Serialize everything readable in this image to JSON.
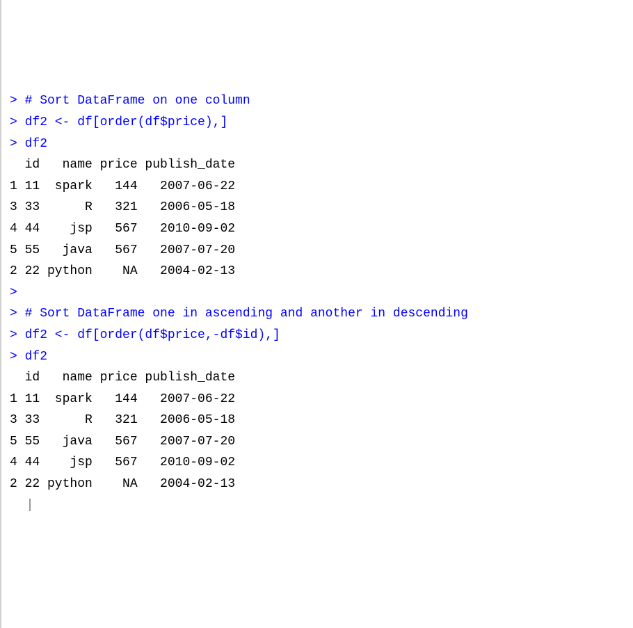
{
  "lines": [
    {
      "type": "prompt",
      "text": "> # Sort DataFrame on one column"
    },
    {
      "type": "prompt",
      "text": "> df2 <- df[order(df$price),]"
    },
    {
      "type": "prompt",
      "text": "> df2"
    },
    {
      "type": "output",
      "text": "  id   name price publish_date"
    },
    {
      "type": "output",
      "text": "1 11  spark   144   2007-06-22"
    },
    {
      "type": "output",
      "text": "3 33      R   321   2006-05-18"
    },
    {
      "type": "output",
      "text": "4 44    jsp   567   2010-09-02"
    },
    {
      "type": "output",
      "text": "5 55   java   567   2007-07-20"
    },
    {
      "type": "output",
      "text": "2 22 python    NA   2004-02-13"
    },
    {
      "type": "prompt",
      "text": "> "
    },
    {
      "type": "prompt",
      "text": "> # Sort DataFrame one in ascending and another in descending"
    },
    {
      "type": "prompt",
      "text": "> df2 <- df[order(df$price,-df$id),]"
    },
    {
      "type": "prompt",
      "text": "> df2"
    },
    {
      "type": "output",
      "text": "  id   name price publish_date"
    },
    {
      "type": "output",
      "text": "1 11  spark   144   2007-06-22"
    },
    {
      "type": "output",
      "text": "3 33      R   321   2006-05-18"
    },
    {
      "type": "output",
      "text": "5 55   java   567   2007-07-20"
    },
    {
      "type": "output",
      "text": "4 44    jsp   567   2010-09-02"
    },
    {
      "type": "output",
      "text": "2 22 python    NA   2004-02-13"
    }
  ]
}
